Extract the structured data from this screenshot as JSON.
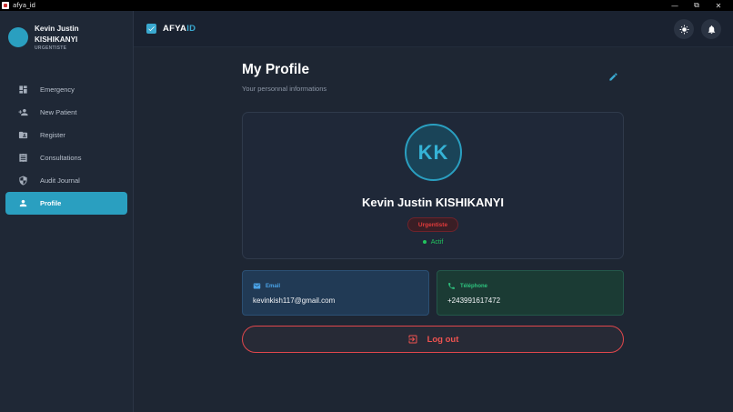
{
  "window": {
    "title": "afya_id",
    "min_icon": "minimize-icon",
    "max_icon": "restore-icon",
    "close_icon": "close-icon"
  },
  "user": {
    "name": "Kevin Justin KISHIKANYI",
    "role": "URGENTISTE"
  },
  "sidebar": {
    "items": [
      {
        "label": "Emergency",
        "icon": "dashboard-icon"
      },
      {
        "label": "New Patient",
        "icon": "person-add-icon"
      },
      {
        "label": "Register",
        "icon": "folder-shared-icon"
      },
      {
        "label": "Consultations",
        "icon": "receipt-icon"
      },
      {
        "label": "Audit Journal",
        "icon": "shield-icon"
      },
      {
        "label": "Profile",
        "icon": "person-icon",
        "active": true
      }
    ]
  },
  "header": {
    "brand_main": "AFYA",
    "brand_accent": "ID",
    "theme_icon": "sun-icon",
    "notif_icon": "bell-icon"
  },
  "profile": {
    "title": "My Profile",
    "subtitle": "Your personnal informations",
    "initials": "KK",
    "full_name": "Kevin Justin KISHIKANYI",
    "role_badge": "Urgentiste",
    "status": "Actif",
    "email_label": "Email",
    "email": "kevinkish117@gmail.com",
    "phone_label": "Téléphone",
    "phone": "+243991617472",
    "logout_label": "Log out"
  },
  "colors": {
    "accent": "#2a9fc0",
    "background": "#1e2633",
    "danger": "#ef5350",
    "success": "#22c55e"
  }
}
